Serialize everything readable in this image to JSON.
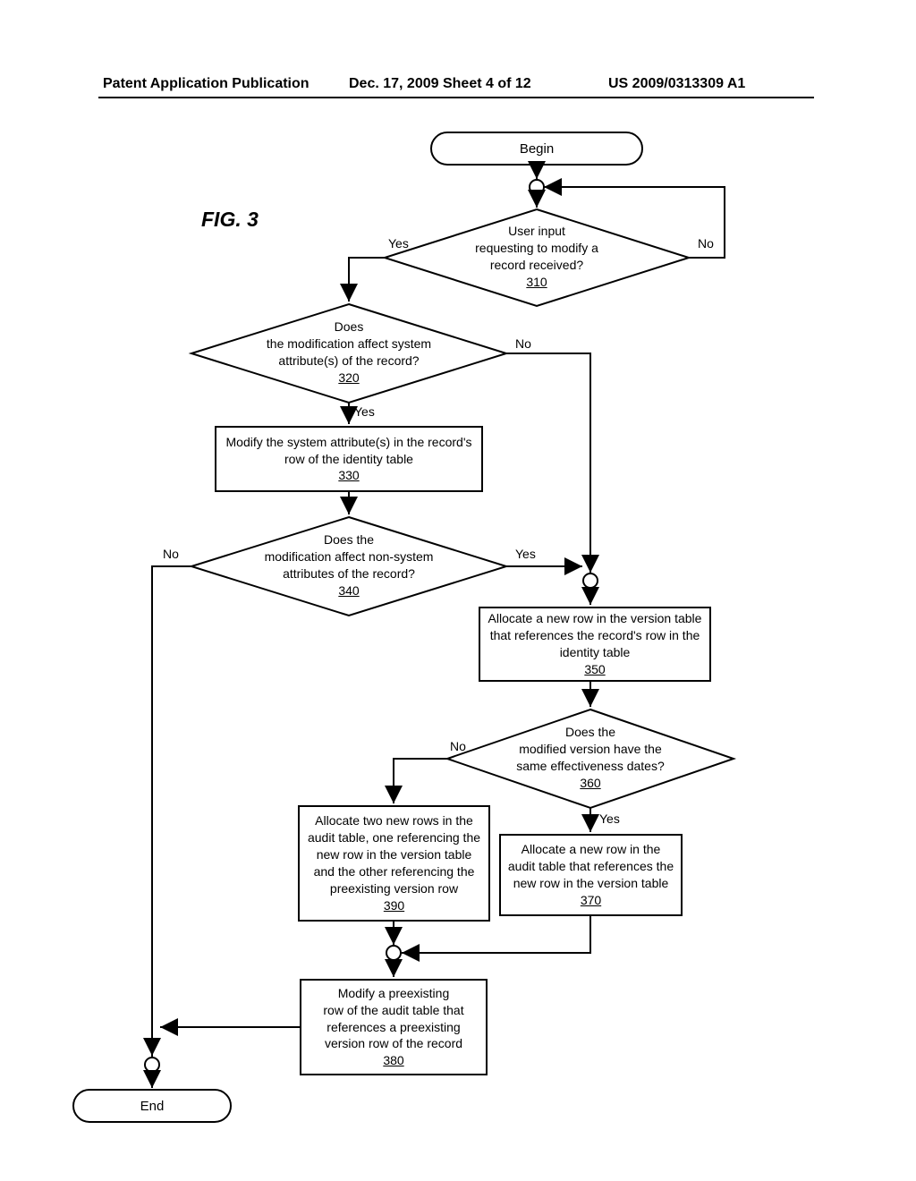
{
  "header": {
    "left": "Patent Application Publication",
    "mid": "Dec. 17, 2009  Sheet 4 of 12",
    "right": "US 2009/0313309 A1"
  },
  "fig_label": "FIG. 3",
  "chart_data": {
    "type": "flowchart",
    "nodes": [
      {
        "id": "begin",
        "kind": "terminator",
        "label": "Begin"
      },
      {
        "id": "310",
        "kind": "decision",
        "label": "User input requesting to modify a record received?",
        "ref": "310"
      },
      {
        "id": "320",
        "kind": "decision",
        "label": "Does the modification affect system attribute(s) of the record?",
        "ref": "320"
      },
      {
        "id": "330",
        "kind": "process",
        "label": "Modify the system attribute(s) in the record's row of the identity table",
        "ref": "330"
      },
      {
        "id": "340",
        "kind": "decision",
        "label": "Does the modification affect non-system attributes of the record?",
        "ref": "340"
      },
      {
        "id": "350",
        "kind": "process",
        "label": "Allocate a new row in the version table that references the record's row in the identity table",
        "ref": "350"
      },
      {
        "id": "360",
        "kind": "decision",
        "label": "Does the modified version have the same effectiveness dates?",
        "ref": "360"
      },
      {
        "id": "370",
        "kind": "process",
        "label": "Allocate a new row in the audit table that references the new row in the version table",
        "ref": "370"
      },
      {
        "id": "380",
        "kind": "process",
        "label": "Modify a preexisting row of the audit table that references a preexisting version row of the record",
        "ref": "380"
      },
      {
        "id": "390",
        "kind": "process",
        "label": "Allocate two new rows in the audit table, one referencing the new row in the version table and the other referencing the preexisting version row",
        "ref": "390"
      },
      {
        "id": "end",
        "kind": "terminator",
        "label": "End"
      }
    ],
    "edges": [
      {
        "from": "begin",
        "to": "310"
      },
      {
        "from": "310",
        "to": "320",
        "label": "Yes"
      },
      {
        "from": "310",
        "to": "310",
        "label": "No",
        "loop": true
      },
      {
        "from": "320",
        "to": "330",
        "label": "Yes"
      },
      {
        "from": "320",
        "to": "350",
        "label": "No"
      },
      {
        "from": "330",
        "to": "340"
      },
      {
        "from": "340",
        "to": "350",
        "label": "Yes"
      },
      {
        "from": "340",
        "to": "end",
        "label": "No"
      },
      {
        "from": "350",
        "to": "360"
      },
      {
        "from": "360",
        "to": "370",
        "label": "Yes"
      },
      {
        "from": "360",
        "to": "390",
        "label": "No"
      },
      {
        "from": "370",
        "to": "380"
      },
      {
        "from": "390",
        "to": "380"
      },
      {
        "from": "380",
        "to": "end"
      }
    ]
  },
  "nodes": {
    "begin": {
      "label": "Begin"
    },
    "n310": {
      "l1": "User input",
      "l2": "requesting to modify a",
      "l3": "record received?",
      "ref": "310"
    },
    "n320": {
      "l1": "Does",
      "l2": "the modification affect system",
      "l3": "attribute(s) of the  record?",
      "ref": "320"
    },
    "n330": {
      "l1": "Modify the system attribute(s) in the record's",
      "l2": "row of the identity table",
      "ref": "330"
    },
    "n340": {
      "l1": "Does the",
      "l2": "modification affect non-system",
      "l3": "attributes of the record?",
      "ref": "340"
    },
    "n350": {
      "l1": "Allocate a new row in the version table",
      "l2": "that references the record's row in the",
      "l3": "identity table",
      "ref": "350"
    },
    "n360": {
      "l1": "Does the",
      "l2": "modified version have the",
      "l3": "same effectiveness dates?",
      "ref": "360"
    },
    "n370": {
      "l1": "Allocate a new row in the",
      "l2": "audit table that references the",
      "l3": "new row in the version table",
      "ref": "370"
    },
    "n380": {
      "l1": "Modify a preexisting",
      "l2": "row of the audit table that",
      "l3": "references a preexisting",
      "l4": "version row of the record",
      "ref": "380"
    },
    "n390": {
      "l1": "Allocate two new rows in the",
      "l2": "audit table, one referencing the",
      "l3": "new row in the version table",
      "l4": "and the other referencing the",
      "l5": "preexisting version row",
      "ref": "390"
    },
    "end": {
      "label": "End"
    }
  },
  "labels": {
    "yes": "Yes",
    "no": "No"
  }
}
